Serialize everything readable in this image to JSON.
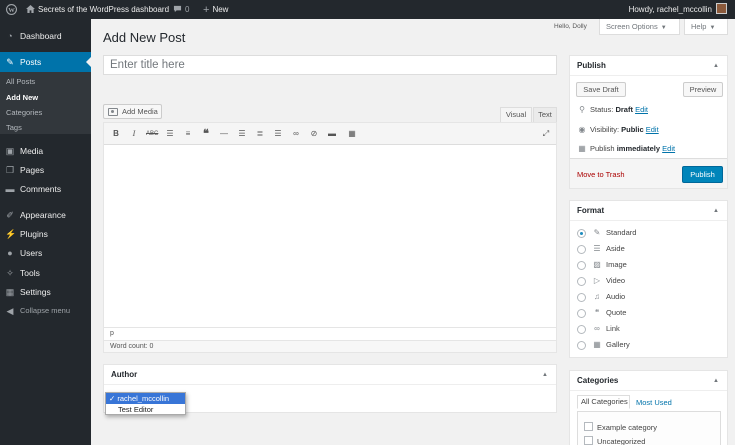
{
  "adminbar": {
    "site_name": "Secrets of the WordPress dashboard",
    "comments_count": "0",
    "new_label": "New",
    "howdy": "Howdy, rachel_mccollin"
  },
  "sidebar": {
    "items": [
      {
        "label": "Dashboard",
        "icon": "dashboard-icon"
      },
      {
        "label": "Posts",
        "icon": "pin-icon"
      },
      {
        "label": "Media",
        "icon": "media-icon"
      },
      {
        "label": "Pages",
        "icon": "pages-icon"
      },
      {
        "label": "Comments",
        "icon": "comments-icon"
      },
      {
        "label": "Appearance",
        "icon": "brush-icon"
      },
      {
        "label": "Plugins",
        "icon": "plug-icon"
      },
      {
        "label": "Users",
        "icon": "users-icon"
      },
      {
        "label": "Tools",
        "icon": "wrench-icon"
      },
      {
        "label": "Settings",
        "icon": "settings-icon"
      },
      {
        "label": "Collapse menu",
        "icon": "collapse-icon"
      }
    ],
    "submenu": [
      "All Posts",
      "Add New",
      "Categories",
      "Tags"
    ]
  },
  "header": {
    "hello_dolly": "Hello, Dolly",
    "screen_options": "Screen Options",
    "help": "Help",
    "page_title": "Add New Post"
  },
  "editor": {
    "title_placeholder": "Enter title here",
    "add_media": "Add Media",
    "tab_visual": "Visual",
    "tab_text": "Text",
    "path": "p",
    "word_count": "Word count: 0"
  },
  "author": {
    "title": "Author",
    "options": [
      "rachel_mccollin",
      "Test Editor"
    ],
    "selected": "✓ rachel_mccollin"
  },
  "publish": {
    "title": "Publish",
    "save_draft": "Save Draft",
    "preview": "Preview",
    "status_label": "Status:",
    "status_value": "Draft",
    "visibility_label": "Visibility:",
    "visibility_value": "Public",
    "publish_label": "Publish",
    "publish_value": "immediately",
    "edit": "Edit",
    "move_to_trash": "Move to Trash",
    "publish_button": "Publish"
  },
  "format": {
    "title": "Format",
    "options": [
      {
        "label": "Standard",
        "icon": "pin-icon",
        "checked": true
      },
      {
        "label": "Aside",
        "icon": "aside-icon",
        "checked": false
      },
      {
        "label": "Image",
        "icon": "image-icon",
        "checked": false
      },
      {
        "label": "Video",
        "icon": "video-icon",
        "checked": false
      },
      {
        "label": "Audio",
        "icon": "audio-icon",
        "checked": false
      },
      {
        "label": "Quote",
        "icon": "quote-icon",
        "checked": false
      },
      {
        "label": "Link",
        "icon": "link-icon",
        "checked": false
      },
      {
        "label": "Gallery",
        "icon": "gallery-icon",
        "checked": false
      }
    ]
  },
  "categories": {
    "title": "Categories",
    "tab_all": "All Categories",
    "tab_used": "Most Used",
    "items": [
      "Example category",
      "Uncategorized"
    ]
  },
  "colors": {
    "adminbar": "#23282d",
    "accent": "#0073aa",
    "publish_button": "#0085ba",
    "trash": "#a00"
  }
}
